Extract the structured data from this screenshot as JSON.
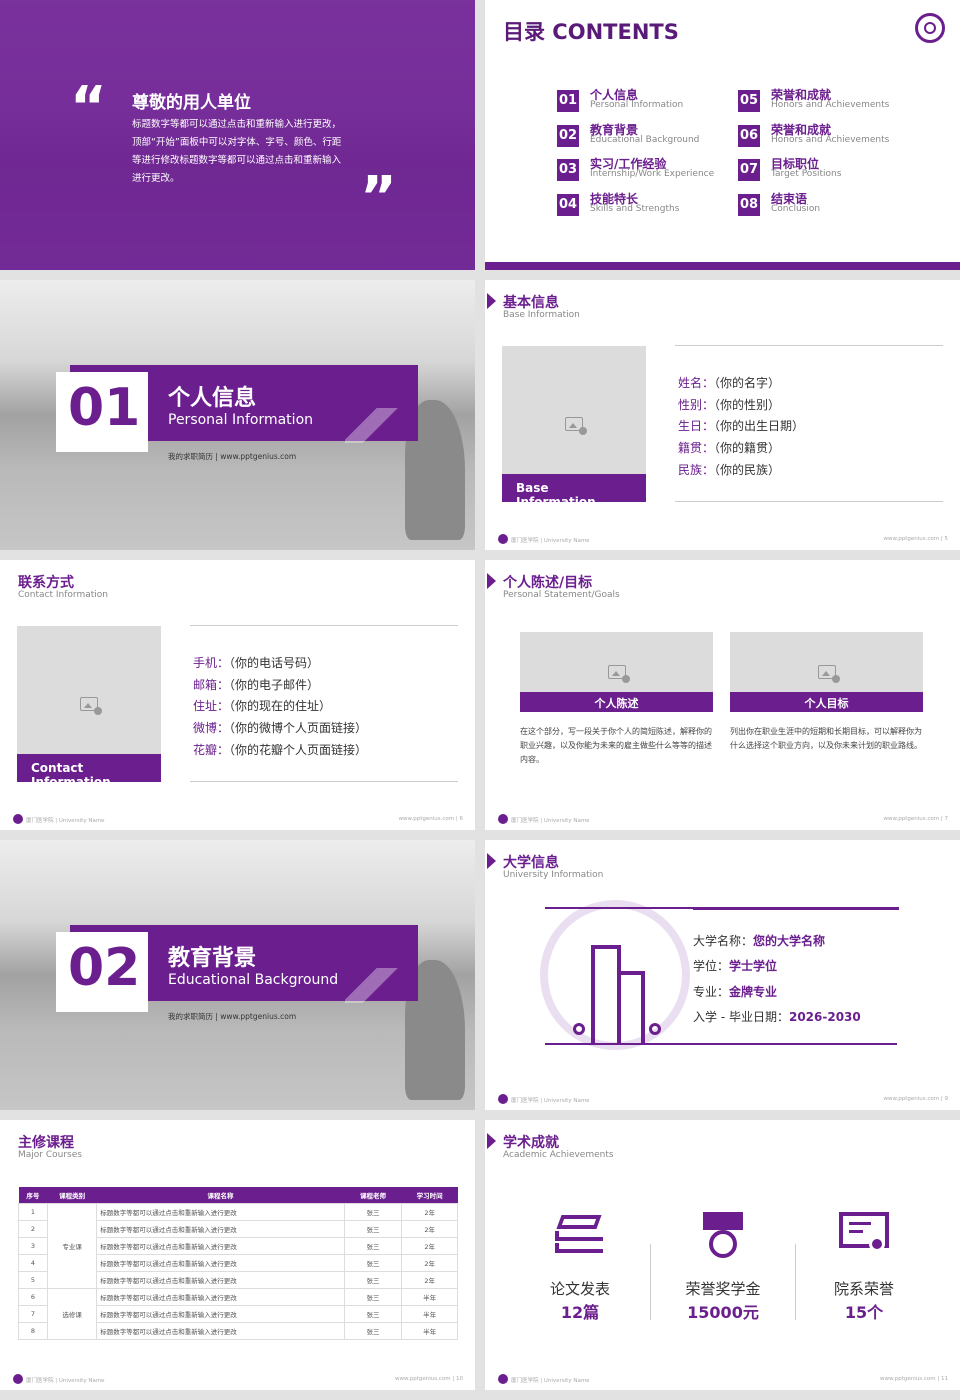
{
  "s1": {
    "title": "尊敬的用人单位",
    "body": "标题数字等都可以通过点击和重新输入进行更改，顶部“开始”面板中可以对字体、字号、颜色、行距等进行修改标题数字等都可以通过点击和重新输入进行更改。",
    "qopen": "“",
    "qclose": "”"
  },
  "s2": {
    "title": "目录 CONTENTS",
    "items": [
      {
        "n": "01",
        "cn": "个人信息",
        "en": "Personal Information"
      },
      {
        "n": "02",
        "cn": "教育背景",
        "en": "Educational Background"
      },
      {
        "n": "03",
        "cn": "实习/工作经验",
        "en": "Internship/Work Experience"
      },
      {
        "n": "04",
        "cn": "技能特长",
        "en": "Skills and Strengths"
      },
      {
        "n": "05",
        "cn": "荣誉和成就",
        "en": "Honors and Achievements"
      },
      {
        "n": "06",
        "cn": "荣誉和成就",
        "en": "Honors and Achievements"
      },
      {
        "n": "07",
        "cn": "目标职位",
        "en": "Target Positions"
      },
      {
        "n": "08",
        "cn": "结束语",
        "en": "Conclusion"
      }
    ]
  },
  "s3": {
    "num": "01",
    "cn": "个人信息",
    "en": "Personal Information",
    "caption": "我的求职简历 | www.pptgenius.com"
  },
  "s4": {
    "title": "基本信息",
    "sub": "Base Information",
    "cap": "Base Information",
    "rows": [
      {
        "k": "姓名：",
        "v": "（你的名字）"
      },
      {
        "k": "性别：",
        "v": "（你的性别）"
      },
      {
        "k": "生日：",
        "v": "（你的出生日期）"
      },
      {
        "k": "籍贯：",
        "v": "（你的籍贯）"
      },
      {
        "k": "民族：",
        "v": "（你的民族）"
      }
    ],
    "foot_l": "厦门医学院 | University Name",
    "foot_r": "www.pptgenius.com  |  5"
  },
  "s5": {
    "title": "联系方式",
    "sub": "Contact Information",
    "cap": "Contact Information",
    "rows": [
      {
        "k": "手机：",
        "v": "（你的电话号码）"
      },
      {
        "k": "邮箱：",
        "v": "（你的电子邮件）"
      },
      {
        "k": "住址：",
        "v": "（你的现在的住址）"
      },
      {
        "k": "微博：",
        "v": "（你的微博个人页面链接）"
      },
      {
        "k": "花瓣：",
        "v": "（你的花瓣个人页面链接）"
      }
    ],
    "foot_l": "厦门医学院 | University Name",
    "foot_r": "www.pptgenius.com  |  6"
  },
  "s6": {
    "title": "个人陈述/目标",
    "sub": "Personal Statement/Goals",
    "c1": "个人陈述",
    "c2": "个人目标",
    "t1": "在这个部分，写一段关于你个人的简短陈述，解释你的职业兴趣，以及你能为未来的雇主做些什么等等的描述内容。",
    "t2": "列出你在职业生涯中的短期和长期目标，可以解释你为什么选择这个职业方向，以及你未来计划的职业路线。",
    "foot_l": "厦门医学院 | University Name",
    "foot_r": "www.pptgenius.com  |  7"
  },
  "s7": {
    "num": "02",
    "cn": "教育背景",
    "en": "Educational Background",
    "caption": "我的求职简历 | www.pptgenius.com"
  },
  "s8": {
    "title": "大学信息",
    "sub": "University Information",
    "rows": [
      {
        "k": "大学名称：",
        "v": "您的大学名称"
      },
      {
        "k": "学位：",
        "v": "学士学位"
      },
      {
        "k": "专业：",
        "v": "金牌专业"
      },
      {
        "k": "入学 - 毕业日期：",
        "v": "2026-2030"
      }
    ],
    "foot_l": "厦门医学院 | University Name",
    "foot_r": "www.pptgenius.com  |  9"
  },
  "s9": {
    "title": "主修课程",
    "sub": "Major Courses",
    "headers": [
      "序号",
      "课程类别",
      "课程名称",
      "课程老师",
      "学习时间"
    ],
    "cat1": "专业课",
    "cat2": "选修课",
    "rows": [
      {
        "no": "1",
        "name": "标题数字等都可以通过点击和重新输入进行更改",
        "teacher": "张三",
        "time": "2年"
      },
      {
        "no": "2",
        "name": "标题数字等都可以通过点击和重新输入进行更改",
        "teacher": "张三",
        "time": "2年"
      },
      {
        "no": "3",
        "name": "标题数字等都可以通过点击和重新输入进行更改",
        "teacher": "张三",
        "time": "2年"
      },
      {
        "no": "4",
        "name": "标题数字等都可以通过点击和重新输入进行更改",
        "teacher": "张三",
        "time": "2年"
      },
      {
        "no": "5",
        "name": "标题数字等都可以通过点击和重新输入进行更改",
        "teacher": "张三",
        "time": "2年"
      },
      {
        "no": "6",
        "name": "标题数字等都可以通过点击和重新输入进行更改",
        "teacher": "张三",
        "time": "半年"
      },
      {
        "no": "7",
        "name": "标题数字等都可以通过点击和重新输入进行更改",
        "teacher": "张三",
        "time": "半年"
      },
      {
        "no": "8",
        "name": "标题数字等都可以通过点击和重新输入进行更改",
        "teacher": "张三",
        "time": "半年"
      }
    ],
    "foot_l": "厦门医学院 | University Name",
    "foot_r": "www.pptgenius.com  |  10"
  },
  "s10": {
    "title": "学术成就",
    "sub": "Academic Achievements",
    "items": [
      {
        "l": "论文发表",
        "v": "12篇"
      },
      {
        "l": "荣誉奖学金",
        "v": "15000元"
      },
      {
        "l": "院系荣誉",
        "v": "15个"
      }
    ],
    "foot_l": "厦门医学院 | University Name",
    "foot_r": "www.pptgenius.com  |  11"
  },
  "colors": {
    "accent": "#6b1f8e"
  }
}
